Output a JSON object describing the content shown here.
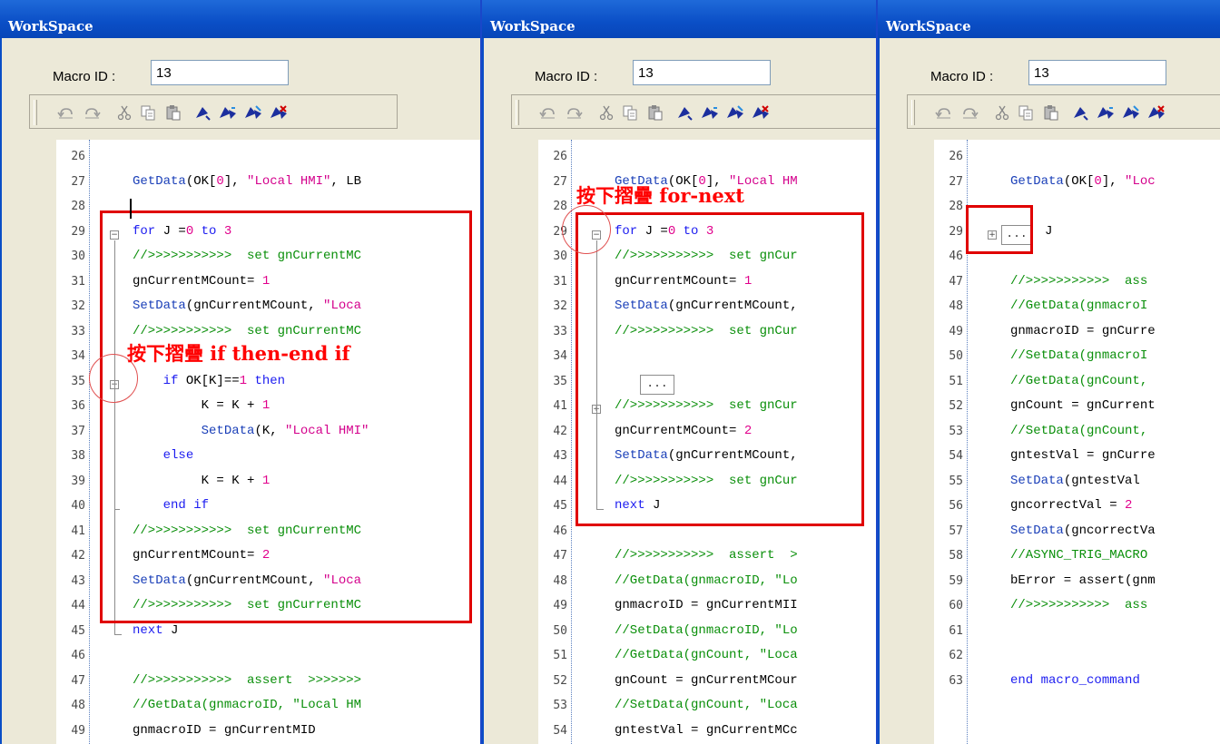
{
  "window_title": "WorkSpace",
  "macro_label": "Macro ID :",
  "macro_id": "13",
  "toolbar_icons": [
    "undo-icon",
    "redo-icon",
    "cut-icon",
    "copy-icon",
    "paste-icon",
    "bookmark-icon",
    "bookmark-next-icon",
    "bookmark-prev-icon",
    "bookmark-clear-icon"
  ],
  "colors": {
    "titlebar": "#0a4ec6",
    "annotation": "#ff0000",
    "keyword": "#1c1cf0",
    "string": "#d4008c",
    "comment": "#0a8f0a"
  },
  "panel1": {
    "annotation": "按下摺疊 if then-end if",
    "line_numbers": [
      "26",
      "27",
      "28",
      "29",
      "30",
      "31",
      "32",
      "33",
      "34",
      "35",
      "36",
      "37",
      "38",
      "39",
      "40",
      "41",
      "42",
      "43",
      "44",
      "45",
      "46",
      "47",
      "48",
      "49"
    ],
    "code": [
      "",
      "GetData(OK[0], \"Local HMI\", LB",
      "",
      "for J =0 to 3",
      "//>>>>>>>>>>>  set gnCurrentMC",
      "gnCurrentMCount= 1",
      "SetData(gnCurrentMCount, \"Loca",
      "//>>>>>>>>>>>  set gnCurrentMC",
      "",
      "    if OK[K]==1 then",
      "         K = K + 1",
      "         SetData(K, \"Local HMI\"",
      "    else",
      "         K = K + 1",
      "    end if",
      "//>>>>>>>>>>>  set gnCurrentMC",
      "gnCurrentMCount= 2",
      "SetData(gnCurrentMCount, \"Loca",
      "//>>>>>>>>>>>  set gnCurrentMC",
      "next J",
      "",
      "//>>>>>>>>>>>  assert  >>>>>>>",
      "//GetData(gnmacroID, \"Local HM",
      "gnmacroID = gnCurrentMID"
    ]
  },
  "panel2": {
    "annotation": "按下摺疊 for-next",
    "collapsed_marker": "...",
    "line_numbers": [
      "26",
      "27",
      "28",
      "29",
      "30",
      "31",
      "32",
      "33",
      "34",
      "35",
      "41",
      "42",
      "43",
      "44",
      "45",
      "46",
      "47",
      "48",
      "49",
      "50",
      "51",
      "52",
      "53",
      "54"
    ],
    "code": [
      "",
      "GetData(OK[0], \"Local HM",
      "",
      "for J =0 to 3",
      "//>>>>>>>>>>>  set gnCur",
      "gnCurrentMCount= 1",
      "SetData(gnCurrentMCount,",
      "//>>>>>>>>>>>  set gnCur",
      "",
      "",
      "//>>>>>>>>>>>  set gnCur",
      "gnCurrentMCount= 2",
      "SetData(gnCurrentMCount,",
      "//>>>>>>>>>>>  set gnCur",
      "next J",
      "",
      "//>>>>>>>>>>>  assert  >",
      "//GetData(gnmacroID, \"Lo",
      "gnmacroID = gnCurrentMII",
      "//SetData(gnmacroID, \"Lo",
      "//GetData(gnCount, \"Loca",
      "gnCount = gnCurrentMCour",
      "//SetData(gnCount, \"Loca",
      "gntestVal = gnCurrentMCc"
    ]
  },
  "panel3": {
    "collapsed_marker": "...",
    "collapsed_suffix": "J",
    "line_numbers": [
      "26",
      "27",
      "28",
      "29",
      "46",
      "47",
      "48",
      "49",
      "50",
      "51",
      "52",
      "53",
      "54",
      "55",
      "56",
      "57",
      "58",
      "59",
      "60",
      "61",
      "62",
      "63"
    ],
    "code": [
      "",
      "GetData(OK[0], \"Loc",
      "",
      "",
      "",
      "//>>>>>>>>>>>  ass",
      "//GetData(gnmacroI",
      "gnmacroID = gnCurre",
      "//SetData(gnmacroI",
      "//GetData(gnCount,",
      "gnCount = gnCurrent",
      "//SetData(gnCount,",
      "gntestVal = gnCurre",
      "SetData(gntestVal",
      "gncorrectVal = 2",
      "SetData(gncorrectVa",
      "//ASYNC_TRIG_MACRO",
      "bError = assert(gnm",
      "//>>>>>>>>>>>  ass",
      "",
      "",
      "end macro_command"
    ]
  }
}
